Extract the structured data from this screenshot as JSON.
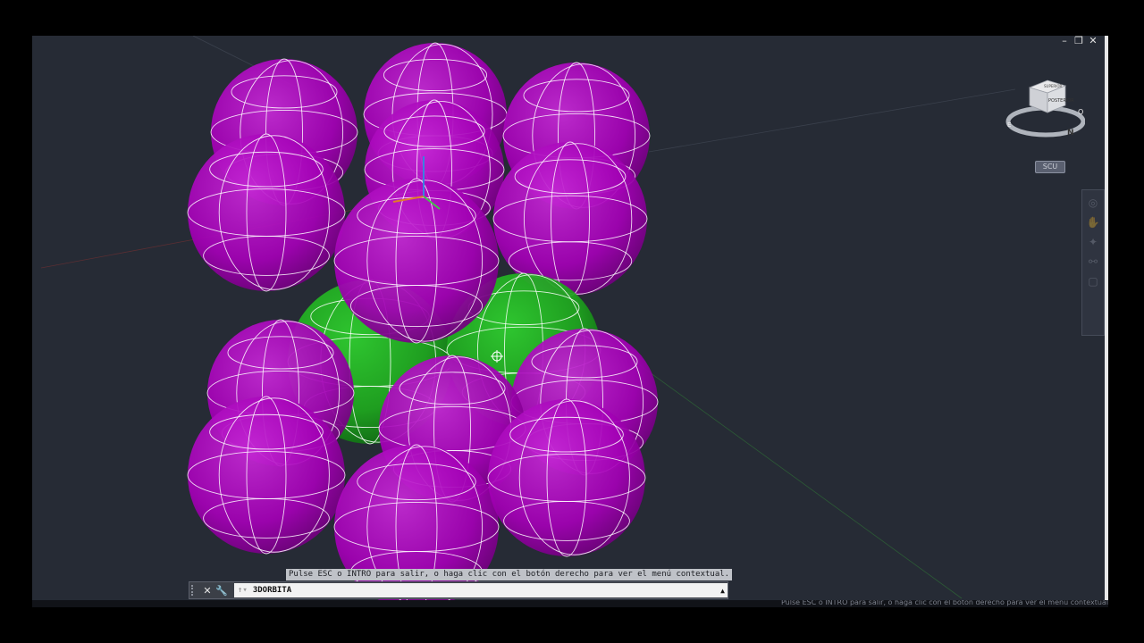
{
  "window": {
    "controls": [
      "minimize",
      "restore",
      "close"
    ]
  },
  "viewcube": {
    "face_top": "SUPERIOR",
    "face_back": "POSTERIOR",
    "compass_n": "N",
    "compass_o": "O",
    "compass_e": "E"
  },
  "wcs_label": "SCU",
  "tooltip": "Pulse ESC o INTRO para salir, o haga clic con el botón derecho para ver el menú contextual.",
  "command": {
    "value": "3DORBITA"
  },
  "status_text": "Pulse ESC o INTRO para salir, o haga clic con el botón derecho para ver el menú contextual.",
  "colors": {
    "sphere_magenta": "#a300b5",
    "sphere_green": "#1ea61e",
    "background": "#262b35",
    "wireframe": "#ffffff"
  }
}
